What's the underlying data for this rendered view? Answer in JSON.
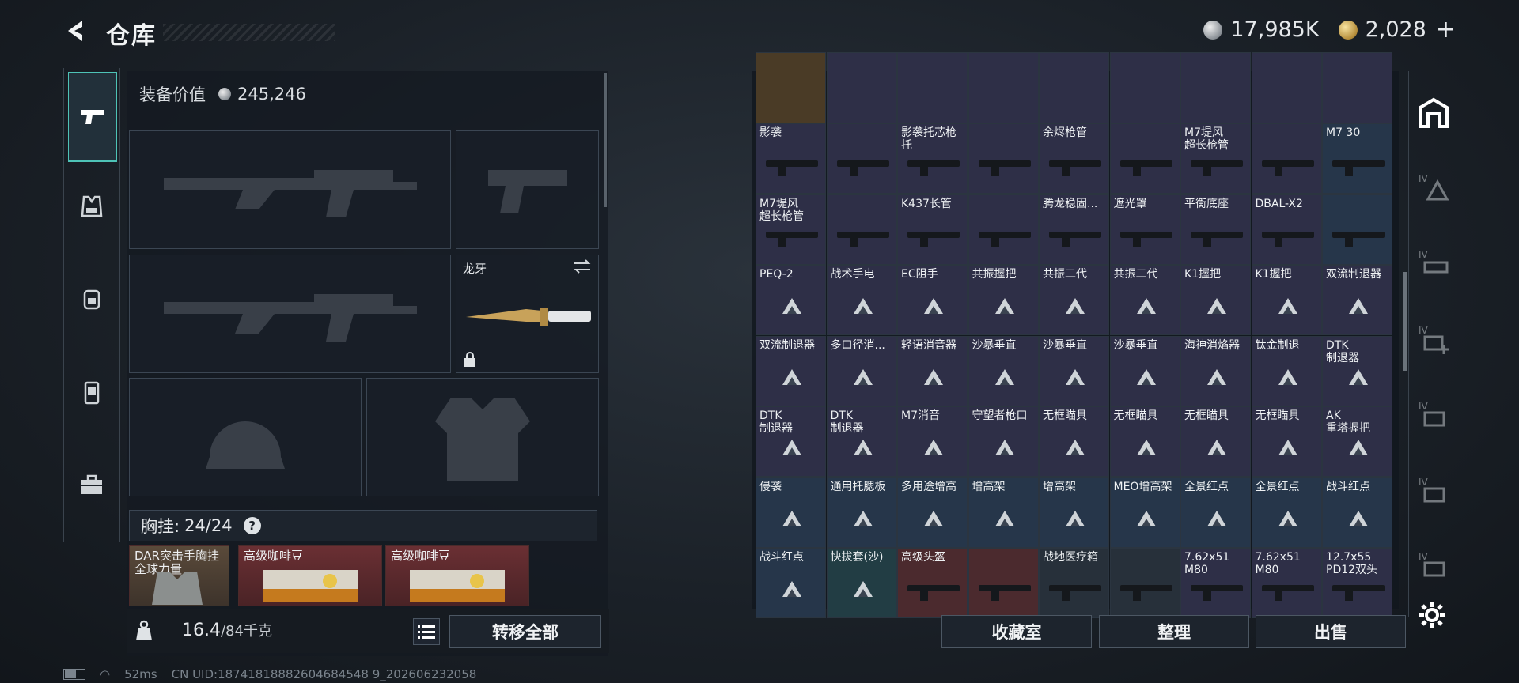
{
  "header": {
    "title": "仓库"
  },
  "currency": {
    "silver": "17,985K",
    "gold": "2,028"
  },
  "equipment": {
    "value_label": "装备价值",
    "value": "245,246",
    "knife_name": "龙牙",
    "vest_label": "胸挂:",
    "vest_capacity": "24/24",
    "vest_help": "?",
    "items": [
      {
        "label": "DAR突击手胸挂\n全球力量"
      },
      {
        "label": "高级咖啡豆"
      },
      {
        "label": "高级咖啡豆"
      }
    ]
  },
  "weight": {
    "current": "16.4",
    "max": "/84千克"
  },
  "buttons": {
    "transfer_all": "转移全部",
    "collection": "收藏室",
    "sort": "整理",
    "sell": "出售"
  },
  "storage": {
    "rows": [
      [
        {
          "name": "影袭",
          "bg": "purple"
        },
        {
          "name": "",
          "bg": "purple"
        },
        {
          "name": "影袭托芯枪托",
          "bg": "purple"
        },
        {
          "name": "",
          "bg": "purple"
        },
        {
          "name": "余烬枪管",
          "bg": "purple"
        },
        {
          "name": "",
          "bg": "purple"
        },
        {
          "name": "M7堤风\n超长枪管",
          "bg": "purple"
        },
        {
          "name": "",
          "bg": "purple"
        },
        {
          "name": "M7 30",
          "bg": "blue"
        }
      ],
      [
        {
          "name": "M7堤风\n超长枪管",
          "bg": "purple"
        },
        {
          "name": "",
          "bg": "purple"
        },
        {
          "name": "K437长管",
          "bg": "purple"
        },
        {
          "name": "",
          "bg": "purple"
        },
        {
          "name": "腾龙稳固...",
          "bg": "purple"
        },
        {
          "name": "遮光罩",
          "bg": "purple"
        },
        {
          "name": "平衡底座",
          "bg": "purple"
        },
        {
          "name": "DBAL-X2",
          "bg": "purple"
        },
        {
          "name": "",
          "bg": "blue"
        }
      ],
      [
        {
          "name": "PEQ-2",
          "bg": "purple"
        },
        {
          "name": "战术手电",
          "bg": "purple"
        },
        {
          "name": "EC阻手",
          "bg": "purple"
        },
        {
          "name": "共振握把",
          "bg": "purple"
        },
        {
          "name": "共振二代",
          "bg": "purple"
        },
        {
          "name": "共振二代",
          "bg": "purple"
        },
        {
          "name": "K1握把",
          "bg": "purple"
        },
        {
          "name": "K1握把",
          "bg": "purple"
        },
        {
          "name": "双流制退器",
          "bg": "purple"
        }
      ],
      [
        {
          "name": "双流制退器",
          "bg": "purple"
        },
        {
          "name": "多口径消...",
          "bg": "purple"
        },
        {
          "name": "轻语消音器",
          "bg": "purple"
        },
        {
          "name": "沙暴垂直",
          "bg": "purple"
        },
        {
          "name": "沙暴垂直",
          "bg": "purple"
        },
        {
          "name": "沙暴垂直",
          "bg": "purple"
        },
        {
          "name": "海神消焰器",
          "bg": "purple"
        },
        {
          "name": "钛金制退",
          "bg": "purple"
        },
        {
          "name": "DTK\n制退器",
          "bg": "purple"
        }
      ],
      [
        {
          "name": "DTK\n制退器",
          "bg": "purple"
        },
        {
          "name": "DTK\n制退器",
          "bg": "purple"
        },
        {
          "name": "M7消音",
          "bg": "purple"
        },
        {
          "name": "守望者枪口",
          "bg": "purple"
        },
        {
          "name": "无框瞄具",
          "bg": "purple"
        },
        {
          "name": "无框瞄具",
          "bg": "purple"
        },
        {
          "name": "无框瞄具",
          "bg": "purple"
        },
        {
          "name": "无框瞄具",
          "bg": "purple"
        },
        {
          "name": "AK\n重塔握把",
          "bg": "purple"
        }
      ],
      [
        {
          "name": "侵袭",
          "bg": "blue"
        },
        {
          "name": "通用托腮板",
          "bg": "blue"
        },
        {
          "name": "多用途增高",
          "bg": "blue"
        },
        {
          "name": "增高架",
          "bg": "blue"
        },
        {
          "name": "增高架",
          "bg": "blue"
        },
        {
          "name": "MEO增高架",
          "bg": "blue"
        },
        {
          "name": "全景红点",
          "bg": "blue"
        },
        {
          "name": "全景红点",
          "bg": "blue"
        },
        {
          "name": "战斗红点",
          "bg": "blue"
        }
      ],
      [
        {
          "name": "战斗红点",
          "bg": "blue"
        },
        {
          "name": "快拔套(沙)",
          "bg": "teal"
        },
        {
          "name": "高级头盔",
          "bg": "red"
        },
        {
          "name": "",
          "bg": "red"
        },
        {
          "name": "战地医疗箱",
          "bg": "gray"
        },
        {
          "name": "",
          "bg": "gray"
        },
        {
          "name": "7.62x51\nM80",
          "bg": "purple"
        },
        {
          "name": "7.62x51\nM80",
          "bg": "purple"
        },
        {
          "name": "12.7x55\nPD12双头",
          "bg": "purple"
        }
      ]
    ]
  },
  "status": {
    "ping": "52ms",
    "uid": "CN UID:18741818882604684548 9_202606232058"
  },
  "colors": {
    "accent": "#4ec3b7",
    "purple_cell": "#2e2f47",
    "blue_cell": "#26364a"
  }
}
